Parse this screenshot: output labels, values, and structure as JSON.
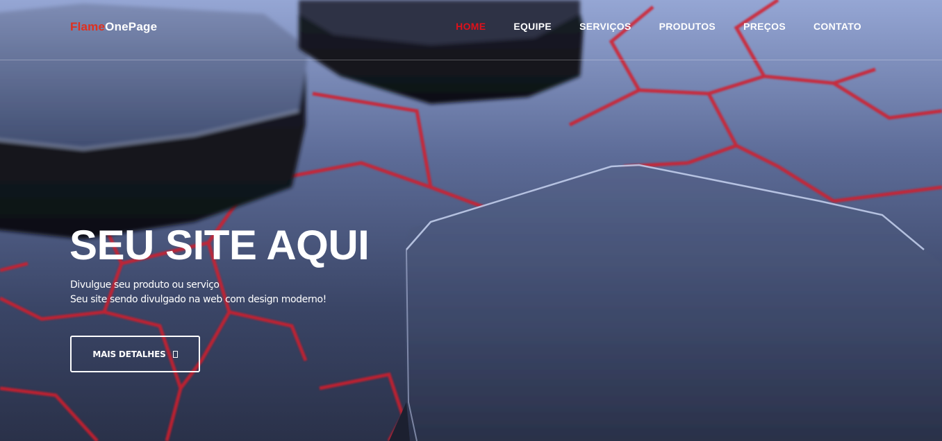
{
  "brand": {
    "part1": "Flame",
    "part2": "OnePage"
  },
  "nav": {
    "items": [
      {
        "label": "HOME",
        "active": true
      },
      {
        "label": "EQUIPE",
        "active": false
      },
      {
        "label": "SERVIÇOS",
        "active": false
      },
      {
        "label": "PRODUTOS",
        "active": false
      },
      {
        "label": "PREÇOS",
        "active": false
      },
      {
        "label": "CONTATO",
        "active": false
      }
    ]
  },
  "hero": {
    "title": "SEU SITE AQUI",
    "subtitle_line1": "Divulgue seu produto ou serviço",
    "subtitle_line2": "Seu site sendo divulgado na web com design moderno!",
    "button_label": "MAIS DETALHES",
    "button_icon": "arrow-box-icon"
  },
  "colors": {
    "accent": "#e0101a",
    "brand_red": "#e0301e",
    "text": "#ffffff",
    "bg_top": "#8a9cc8",
    "bg_bottom": "#28314d",
    "hex_lines": "#d41c2c"
  }
}
